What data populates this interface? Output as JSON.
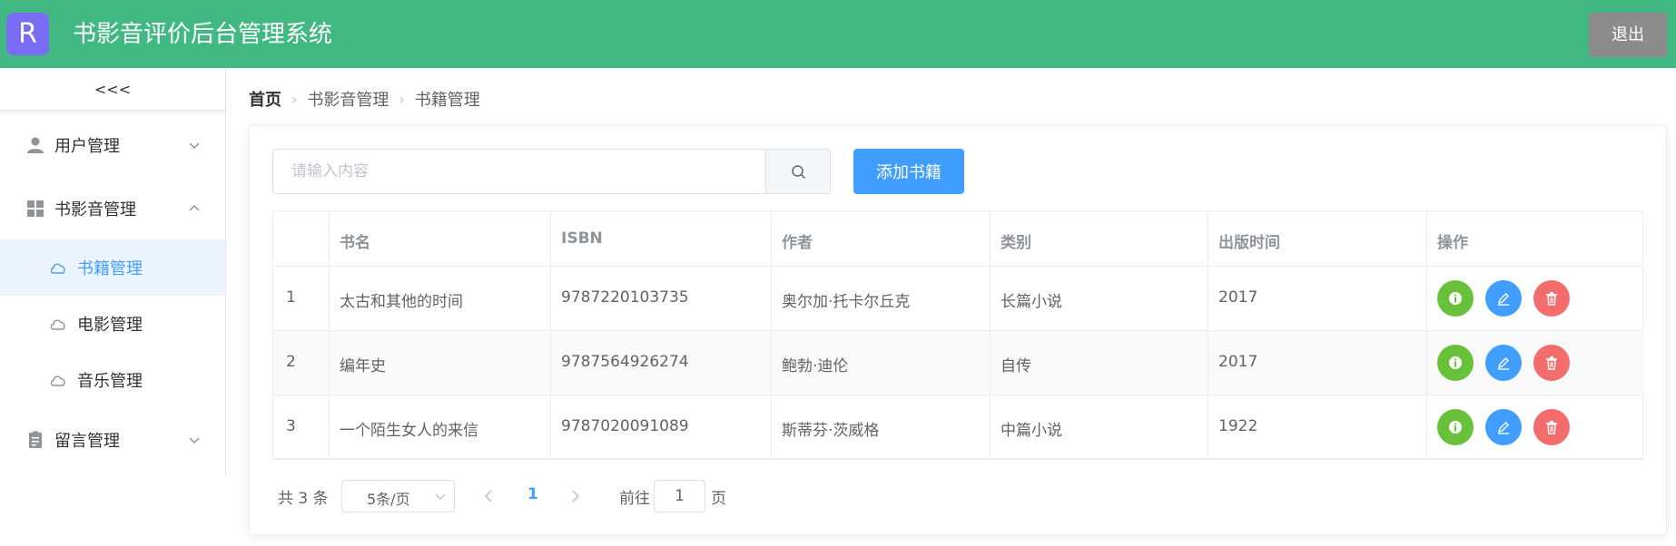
{
  "header": {
    "logo_letter": "R",
    "title": "书影音评价后台管理系统",
    "logout_label": "退出",
    "bg_color": "#42b983"
  },
  "sidebar": {
    "collapse_label": "<<<",
    "menus": [
      {
        "label": "用户管理",
        "icon": "user-icon",
        "expanded": false
      },
      {
        "label": "书影音管理",
        "icon": "grid-icon",
        "expanded": true,
        "children": [
          {
            "label": "书籍管理",
            "icon": "cloud-icon",
            "active": true
          },
          {
            "label": "电影管理",
            "icon": "cloud-icon",
            "active": false
          },
          {
            "label": "音乐管理",
            "icon": "cloud-icon",
            "active": false
          }
        ]
      },
      {
        "label": "留言管理",
        "icon": "clipboard-icon",
        "expanded": false
      }
    ]
  },
  "breadcrumb": [
    "首页",
    "书影音管理",
    "书籍管理"
  ],
  "toolbar": {
    "search_placeholder": "请输入内容",
    "search_value": "",
    "add_label": "添加书籍"
  },
  "table": {
    "columns": [
      "",
      "书名",
      "ISBN",
      "作者",
      "类别",
      "出版时间",
      "操作"
    ],
    "rows": [
      {
        "index": "1",
        "title": "太古和其他的时间",
        "isbn": "9787220103735",
        "author": "奥尔加·托卡尔丘克",
        "category": "长篇小说",
        "year": "2017"
      },
      {
        "index": "2",
        "title": "编年史",
        "isbn": "9787564926274",
        "author": "鲍勃·迪伦",
        "category": "自传",
        "year": "2017"
      },
      {
        "index": "3",
        "title": "一个陌生女人的来信",
        "isbn": "9787020091089",
        "author": "斯蒂芬·茨威格",
        "category": "中篇小说",
        "year": "1922"
      }
    ],
    "actions": [
      {
        "name": "info",
        "icon": "info-icon",
        "color": "#67c23a"
      },
      {
        "name": "edit",
        "icon": "edit-icon",
        "color": "#409eff"
      },
      {
        "name": "delete",
        "icon": "delete-icon",
        "color": "#f56c6c"
      }
    ]
  },
  "pagination": {
    "total_label": "共 3 条",
    "page_size_label": "5条/页",
    "current_page": "1",
    "goto_prefix": "前往",
    "goto_value": "1",
    "goto_suffix": "页"
  },
  "colors": {
    "accent": "#409eff",
    "success": "#67c23a",
    "danger": "#f56c6c"
  }
}
